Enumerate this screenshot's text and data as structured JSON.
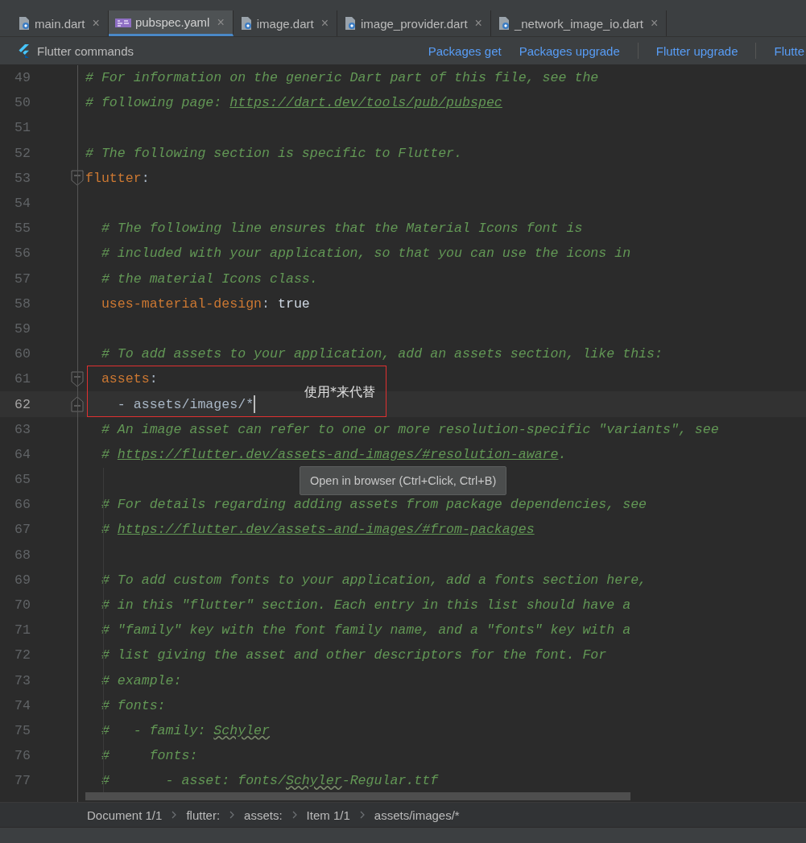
{
  "tabs": [
    {
      "label": "main.dart",
      "kind": "dart",
      "selected": false,
      "close": "×"
    },
    {
      "label": "pubspec.yaml",
      "kind": "yaml",
      "selected": true,
      "close": "×"
    },
    {
      "label": "image.dart",
      "kind": "dart",
      "selected": false,
      "close": "×"
    },
    {
      "label": "image_provider.dart",
      "kind": "dart",
      "selected": false,
      "close": "×"
    },
    {
      "label": "_network_image_io.dart",
      "kind": "dart",
      "selected": false,
      "close": "×"
    }
  ],
  "toolbar": {
    "title": "Flutter commands",
    "action_groups": [
      [
        "Packages get",
        "Packages upgrade"
      ],
      [
        "Flutter upgrade"
      ],
      [
        "Flutte"
      ]
    ]
  },
  "editor": {
    "lines": [
      {
        "number": "49",
        "current": false,
        "segments": [
          {
            "kind": "comment",
            "text": "# For information on the generic Dart part of this file, see the"
          }
        ]
      },
      {
        "number": "50",
        "current": false,
        "segments": [
          {
            "kind": "comment",
            "text": "# following page: "
          },
          {
            "kind": "link",
            "text": "https://dart.dev/tools/pub/pubspec"
          }
        ]
      },
      {
        "number": "51",
        "current": false
      },
      {
        "number": "52",
        "current": false,
        "segments": [
          {
            "kind": "comment",
            "text": "# The following section is specific to Flutter."
          }
        ]
      },
      {
        "number": "53",
        "current": false,
        "kind": "fold-start",
        "segments": [
          {
            "kind": "key",
            "text": "flutter"
          },
          {
            "kind": "plain",
            "text": ":"
          }
        ]
      },
      {
        "number": "54",
        "current": false
      },
      {
        "number": "55",
        "current": false,
        "segments": [
          {
            "kind": "comment",
            "text": "  # The following line ensures that the Material Icons font is"
          }
        ]
      },
      {
        "number": "56",
        "current": false,
        "segments": [
          {
            "kind": "comment",
            "text": "  # included with your application, so that you can use the icons in"
          }
        ]
      },
      {
        "number": "57",
        "current": false,
        "segments": [
          {
            "kind": "comment",
            "text": "  # the material Icons class."
          }
        ]
      },
      {
        "number": "58",
        "current": false,
        "segments": [
          {
            "kind": "key",
            "text": "  uses-material-design"
          },
          {
            "kind": "plain",
            "text": ": "
          },
          {
            "kind": "value",
            "text": "true"
          }
        ]
      },
      {
        "number": "59",
        "current": false
      },
      {
        "number": "60",
        "current": false,
        "segments": [
          {
            "kind": "comment",
            "text": "  # To add assets to your application, add an assets section, like this:"
          }
        ]
      },
      {
        "number": "61",
        "current": false,
        "kind": "fold-start",
        "segments": [
          {
            "kind": "key",
            "text": "  assets"
          },
          {
            "kind": "plain",
            "text": ":"
          }
        ]
      },
      {
        "number": "62",
        "current": true,
        "kind": "fold-end",
        "segments": [
          {
            "kind": "plain",
            "text": "    - assets/images/*"
          }
        ]
      },
      {
        "number": "63",
        "current": false,
        "segments": [
          {
            "kind": "comment",
            "text": "  # An image asset can refer to one or more resolution-specific \"variants\", see"
          }
        ]
      },
      {
        "number": "64",
        "current": false,
        "segments": [
          {
            "kind": "comment",
            "text": "  # "
          },
          {
            "kind": "link",
            "text": "https://flutter.dev/assets-and-images/#resolution-aware"
          },
          {
            "kind": "comment",
            "text": "."
          }
        ]
      },
      {
        "number": "65",
        "current": false
      },
      {
        "number": "66",
        "current": false,
        "segments": [
          {
            "kind": "comment",
            "text": "  # For details regarding adding assets from package dependencies, see"
          }
        ]
      },
      {
        "number": "67",
        "current": false,
        "segments": [
          {
            "kind": "comment",
            "text": "  # "
          },
          {
            "kind": "link",
            "text": "https://flutter.dev/assets-and-images/#from-packages"
          }
        ]
      },
      {
        "number": "68",
        "current": false
      },
      {
        "number": "69",
        "current": false,
        "segments": [
          {
            "kind": "comment",
            "text": "  # To add custom fonts to your application, add a fonts section here,"
          }
        ]
      },
      {
        "number": "70",
        "current": false,
        "segments": [
          {
            "kind": "comment",
            "text": "  # in this \"flutter\" section. Each entry in this list should have a"
          }
        ]
      },
      {
        "number": "71",
        "current": false,
        "segments": [
          {
            "kind": "comment",
            "text": "  # \"family\" key with the font family name, and a \"fonts\" key with a"
          }
        ]
      },
      {
        "number": "72",
        "current": false,
        "segments": [
          {
            "kind": "comment",
            "text": "  # list giving the asset and other descriptors for the font. For"
          }
        ]
      },
      {
        "number": "73",
        "current": false,
        "segments": [
          {
            "kind": "comment",
            "text": "  # example:"
          }
        ]
      },
      {
        "number": "74",
        "current": false,
        "segments": [
          {
            "kind": "comment",
            "text": "  # fonts:"
          }
        ]
      },
      {
        "number": "75",
        "current": false,
        "segments": [
          {
            "kind": "comment",
            "text": "  #   - family: "
          },
          {
            "kind": "spelling",
            "text": "Schyler"
          }
        ]
      },
      {
        "number": "76",
        "current": false,
        "segments": [
          {
            "kind": "comment",
            "text": "  #     fonts:"
          }
        ]
      },
      {
        "number": "77",
        "current": false,
        "segments": [
          {
            "kind": "comment",
            "text": "  #       - asset: fonts/"
          },
          {
            "kind": "spelling",
            "text": "Schyler"
          },
          {
            "kind": "comment",
            "text": "-Regular.ttf"
          }
        ]
      }
    ],
    "annotation": {
      "text": "使用*来代替"
    },
    "tooltip": {
      "text": "Open in browser (Ctrl+Click, Ctrl+B)"
    }
  },
  "breadcrumbs": [
    "Document 1/1",
    "flutter:",
    "assets:",
    "Item 1/1",
    "assets/images/*"
  ]
}
